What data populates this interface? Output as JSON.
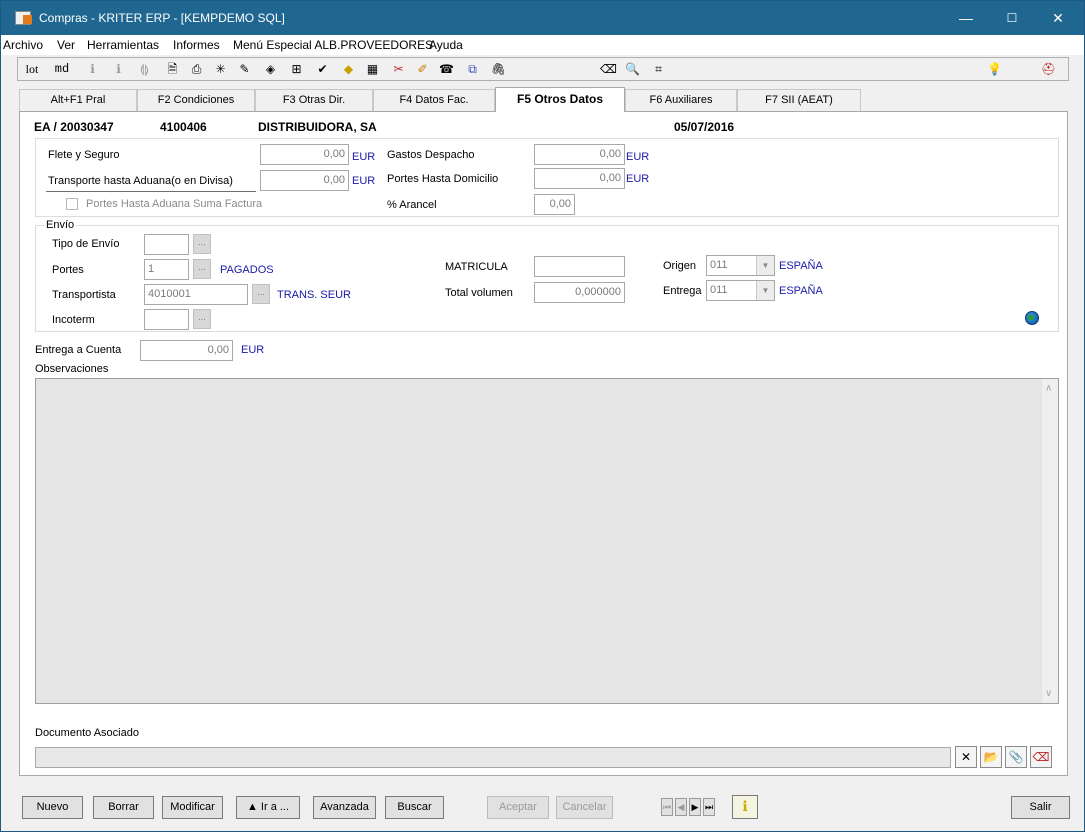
{
  "window": {
    "title": "Compras - KRITER ERP - [KEMPDEMO SQL]",
    "minimize": "—",
    "maximize": "☐",
    "close": "✕"
  },
  "menu": [
    "Archivo",
    "Ver",
    "Herramientas",
    "Informes",
    "Menú Especial ALB.PROVEEDORES",
    "Ayuda"
  ],
  "toolbar": {
    "lot": "lot",
    "md": "md"
  },
  "tabs": [
    "Alt+F1 Pral",
    "F2 Condiciones",
    "F3 Otras Dir.",
    "F4 Datos Fac.",
    "F5 Otros Datos",
    "F6 Auxiliares",
    "F7 SII (AEAT)"
  ],
  "header": {
    "doc": "EA / 20030347",
    "code": "4100406",
    "name": "DISTRIBUIDORA, SA",
    "date": "05/07/2016"
  },
  "costs": {
    "flete_label": "Flete y Seguro",
    "flete_value": "0,00",
    "flete_currency": "EUR",
    "transporte_label": "Transporte hasta Aduana(o en Divisa)",
    "transporte_value": "0,00",
    "transporte_currency": "EUR",
    "portes_aduana_label": "Portes Hasta Aduana Suma Factura",
    "gastos_label": "Gastos Despacho",
    "gastos_value": "0,00",
    "gastos_currency": "EUR",
    "portes_dom_label": "Portes Hasta Domicilio",
    "portes_dom_value": "0,00",
    "portes_dom_currency": "EUR",
    "arancel_label": "% Arancel",
    "arancel_value": "0,00"
  },
  "envio": {
    "legend": "Envío",
    "tipo_label": "Tipo de Envío",
    "tipo_value": "",
    "portes_label": "Portes",
    "portes_value": "1",
    "portes_desc": "PAGADOS",
    "transportista_label": "Transportista",
    "transportista_value": "4010001",
    "transportista_desc": "TRANS. SEUR",
    "incoterm_label": "Incoterm",
    "incoterm_value": "",
    "matricula_label": "MATRICULA",
    "matricula_value": "",
    "volumen_label": "Total volumen",
    "volumen_value": "0,000000",
    "origen_label": "Origen",
    "origen_value": "011",
    "origen_desc": "ESPAÑA",
    "entrega_label": "Entrega",
    "entrega_value": "011",
    "entrega_desc": "ESPAÑA",
    "ellipsis": "..."
  },
  "entrega_cuenta": {
    "label": "Entrega a Cuenta",
    "value": "0,00",
    "currency": "EUR"
  },
  "observaciones": {
    "label": "Observaciones"
  },
  "documento": {
    "label": "Documento Asociado",
    "value": ""
  },
  "buttons": {
    "nuevo": "Nuevo",
    "borrar": "Borrar",
    "modificar": "Modificar",
    "ira": "▲ Ir a ...",
    "avanzada": "Avanzada",
    "buscar": "Buscar",
    "aceptar": "Aceptar",
    "cancelar": "Cancelar",
    "salir": "Salir"
  },
  "colors": {
    "titlebar": "#1f6690",
    "accent_text": "#1a1aa8"
  }
}
